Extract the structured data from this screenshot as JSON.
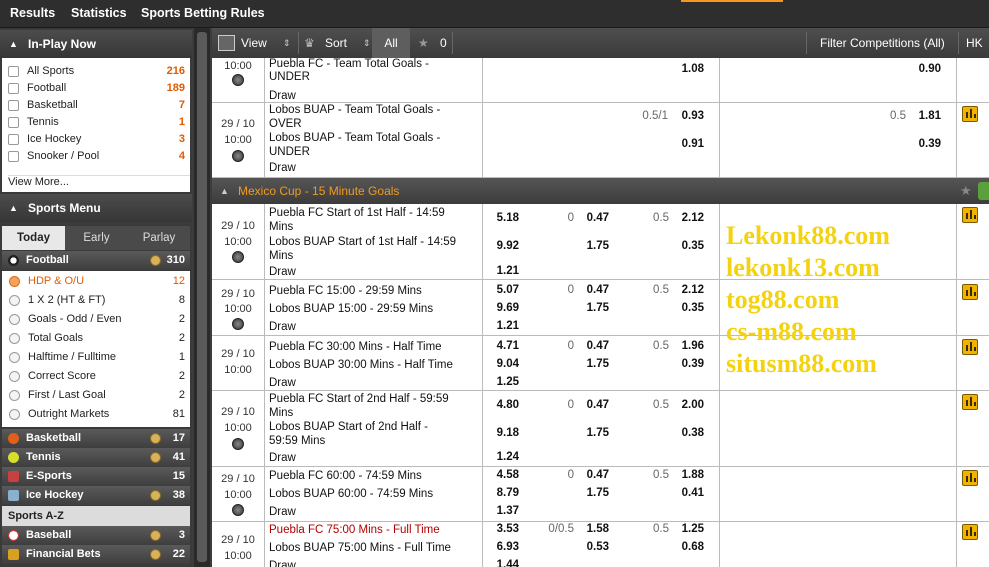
{
  "topnav": {
    "items": [
      "Results",
      "Statistics",
      "Sports Betting Rules"
    ],
    "accent_color": "#f39a1e"
  },
  "inplay": {
    "title": "In-Play Now",
    "items": [
      {
        "label": "All Sports",
        "count": "216"
      },
      {
        "label": "Football",
        "count": "189"
      },
      {
        "label": "Basketball",
        "count": "7"
      },
      {
        "label": "Tennis",
        "count": "1"
      },
      {
        "label": "Ice Hockey",
        "count": "3"
      },
      {
        "label": "Snooker / Pool",
        "count": "4"
      }
    ],
    "view_more": "View More..."
  },
  "sports_menu": {
    "title": "Sports Menu",
    "tabs": [
      "Today",
      "Early",
      "Parlay"
    ],
    "active_tab": "Today",
    "football": {
      "label": "Football",
      "count": "310"
    },
    "markets": [
      {
        "label": "HDP & O/U",
        "count": "12",
        "selected": true
      },
      {
        "label": "1 X 2 (HT & FT)",
        "count": "8"
      },
      {
        "label": "Goals - Odd / Even",
        "count": "2"
      },
      {
        "label": "Total Goals",
        "count": "2"
      },
      {
        "label": "Halftime / Fulltime",
        "count": "1"
      },
      {
        "label": "Correct Score",
        "count": "2"
      },
      {
        "label": "First / Last Goal",
        "count": "2"
      },
      {
        "label": "Outright Markets",
        "count": "81"
      }
    ],
    "sports": [
      {
        "label": "Basketball",
        "count": "17"
      },
      {
        "label": "Tennis",
        "count": "41"
      },
      {
        "label": "E-Sports",
        "count": "15"
      },
      {
        "label": "Ice Hockey",
        "count": "38"
      }
    ],
    "az_label": "Sports A-Z",
    "sports_az": [
      {
        "label": "Baseball",
        "count": "3"
      },
      {
        "label": "Financial Bets",
        "count": "22"
      }
    ]
  },
  "toolbar": {
    "view": "View",
    "sort": "Sort",
    "all": "All",
    "fav_count": "0",
    "filter": "Filter Competitions (All)",
    "odds_type": "HK"
  },
  "grid": {
    "row0": {
      "time": "10:00",
      "team1": "Puebla FC - Team Total Goals -",
      "team2": "UNDER",
      "draw": "Draw",
      "o1": "1.08",
      "o2": "0.90"
    },
    "row1": {
      "date": "29 / 10",
      "time": "10:00",
      "team1a": "Lobos BUAP - Team Total Goals -",
      "team1b": "OVER",
      "team2a": "Lobos BUAP - Team Total Goals -",
      "team2b": "UNDER",
      "draw": "Draw",
      "hdp": "0.5/1",
      "hdp_o1": "0.93",
      "hdp_o2": "0.91",
      "ou": "0.5",
      "ou_o1": "1.81",
      "ou_o2": "0.39"
    },
    "competition": "Mexico Cup - 15 Minute Goals",
    "events": [
      {
        "date": "29 / 10",
        "time": "10:00",
        "team1": [
          "Puebla FC Start of 1st Half - 14:59",
          "Mins"
        ],
        "team2": [
          "Lobos BUAP Start of 1st Half - 14:59",
          "Mins"
        ],
        "draw": "Draw",
        "x12": [
          "5.18",
          "9.92",
          "1.21"
        ],
        "hdp": "0",
        "hdp_odds": [
          "0.47",
          "1.75"
        ],
        "ou": "0.5",
        "ou_odds": [
          "2.12",
          "0.35"
        ]
      },
      {
        "date": "29 / 10",
        "time": "10:00",
        "team1": [
          "Puebla FC 15:00 - 29:59 Mins"
        ],
        "team2": [
          "Lobos BUAP 15:00 - 29:59 Mins"
        ],
        "draw": "Draw",
        "x12": [
          "5.07",
          "9.69",
          "1.21"
        ],
        "hdp": "0",
        "hdp_odds": [
          "0.47",
          "1.75"
        ],
        "ou": "0.5",
        "ou_odds": [
          "2.12",
          "0.35"
        ]
      },
      {
        "date": "29 / 10",
        "time": "10:00",
        "team1": [
          "Puebla FC 30:00 Mins - Half Time"
        ],
        "team2": [
          "Lobos BUAP 30:00 Mins - Half Time"
        ],
        "draw": "Draw",
        "x12": [
          "4.71",
          "9.04",
          "1.25"
        ],
        "hdp": "0",
        "hdp_odds": [
          "0.47",
          "1.75"
        ],
        "ou": "0.5",
        "ou_odds": [
          "1.96",
          "0.39"
        ]
      },
      {
        "date": "29 / 10",
        "time": "10:00",
        "team1": [
          "Puebla FC Start of 2nd Half - 59:59",
          "Mins"
        ],
        "team2": [
          "Lobos BUAP Start of 2nd Half -",
          "59:59 Mins"
        ],
        "draw": "Draw",
        "x12": [
          "4.80",
          "9.18",
          "1.24"
        ],
        "hdp": "0",
        "hdp_odds": [
          "0.47",
          "1.75"
        ],
        "ou": "0.5",
        "ou_odds": [
          "2.00",
          "0.38"
        ]
      },
      {
        "date": "29 / 10",
        "time": "10:00",
        "team1": [
          "Puebla FC 60:00 - 74:59 Mins"
        ],
        "team2": [
          "Lobos BUAP 60:00 - 74:59 Mins"
        ],
        "draw": "Draw",
        "x12": [
          "4.58",
          "8.79",
          "1.37"
        ],
        "hdp": "0",
        "hdp_odds": [
          "0.47",
          "1.75"
        ],
        "ou": "0.5",
        "ou_odds": [
          "1.88",
          "0.41"
        ]
      },
      {
        "date": "29 / 10",
        "time": "10:00",
        "team1": [
          "Puebla FC 75:00 Mins - Full Time"
        ],
        "team2": [
          "Lobos BUAP 75:00 Mins - Full Time"
        ],
        "draw": "Draw",
        "x12": [
          "3.53",
          "6.93",
          "1.44"
        ],
        "hdp": "0/0.5",
        "hdp_odds": [
          "1.58",
          "0.53"
        ],
        "ou": "0.5",
        "ou_odds": [
          "1.25",
          "0.68"
        ]
      }
    ]
  },
  "watermark": {
    "lines": [
      "Lekonk88.com",
      "lekonk13.com",
      "tog88.com",
      "cs-m88.com",
      "situsm88.com"
    ],
    "color": "#f4d20f"
  }
}
